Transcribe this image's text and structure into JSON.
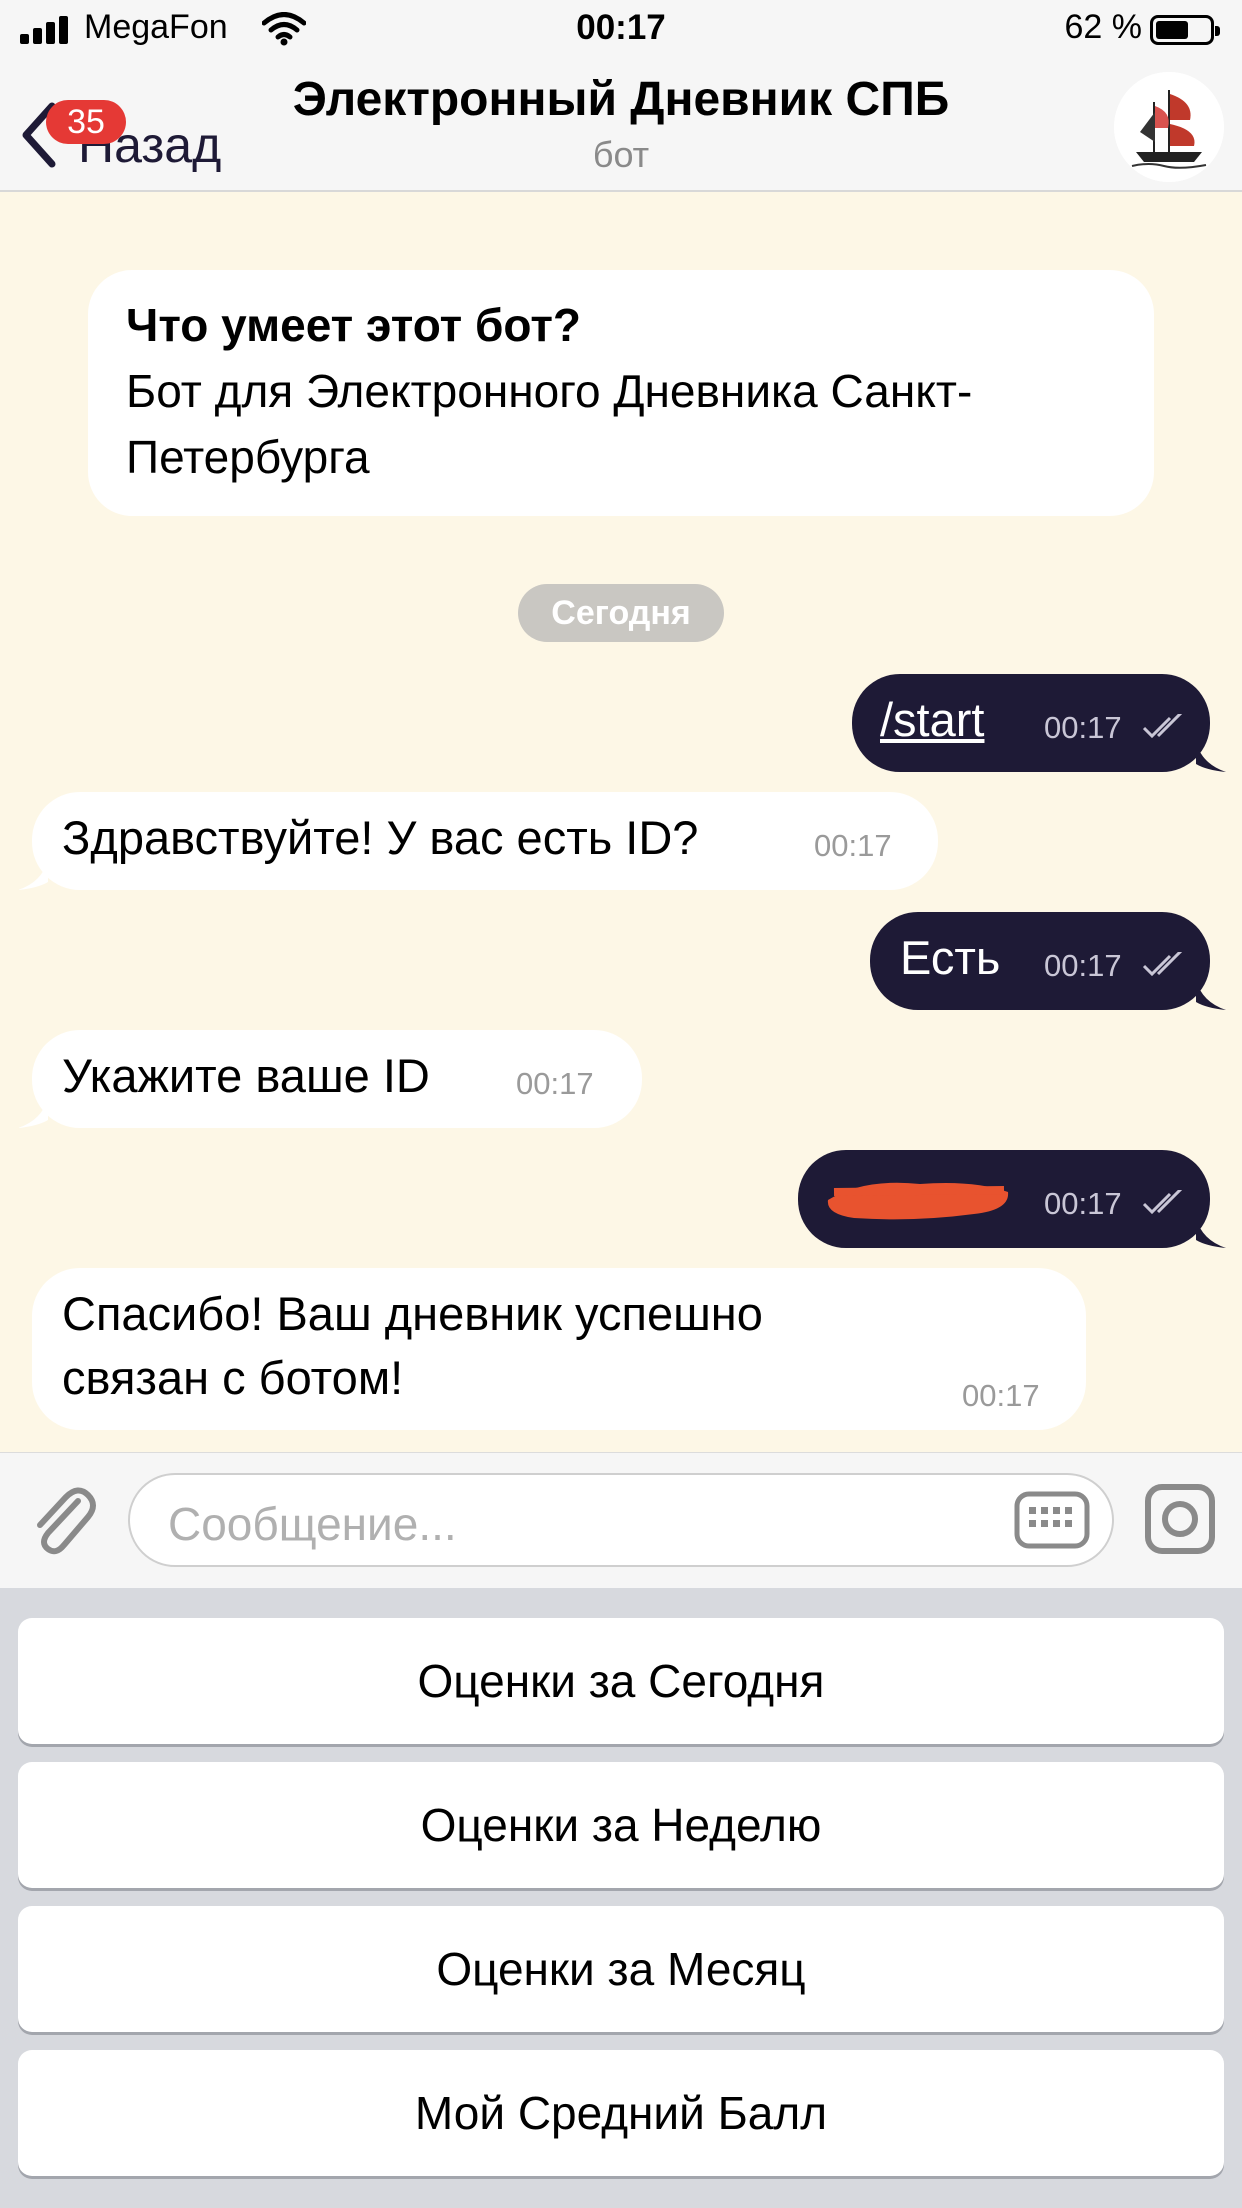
{
  "status_bar": {
    "carrier": "MegaFon",
    "time": "00:17",
    "battery": "62 %",
    "battery_level": 0.62
  },
  "header": {
    "back_label": "Назад",
    "unread_badge": "35",
    "title": "Электронный Дневник СПБ",
    "subtitle": "бот",
    "avatar_icon": "ship-icon"
  },
  "chat": {
    "about": {
      "title": "Что умеет этот бот?",
      "text": "Бот для Электронного Дневника Санкт-Петербурга"
    },
    "date_separator": "Сегодня",
    "messages": [
      {
        "direction": "out",
        "text": "/start",
        "time": "00:17"
      },
      {
        "direction": "in",
        "text": "Здравствуйте! У вас есть ID?",
        "time": "00:17"
      },
      {
        "direction": "out",
        "text": "Есть",
        "time": "00:17"
      },
      {
        "direction": "in",
        "text": "Укажите ваше ID",
        "time": "00:17"
      },
      {
        "direction": "out",
        "text": "",
        "time": "00:17",
        "redacted": true
      },
      {
        "direction": "in",
        "text": "Спасибо! Ваш дневник успешно связан с ботом!",
        "time": "00:17"
      }
    ]
  },
  "composer": {
    "placeholder": "Сообщение..."
  },
  "keyboard": {
    "buttons": [
      "Оценки за Сегодня",
      "Оценки за Неделю",
      "Оценки за Месяц",
      "Мой Средний Балл"
    ]
  },
  "colors": {
    "outgoing_bubble": "#1e1a36",
    "chat_background": "#fdf7e6",
    "badge": "#e53935",
    "redaction": "#e8532f"
  }
}
